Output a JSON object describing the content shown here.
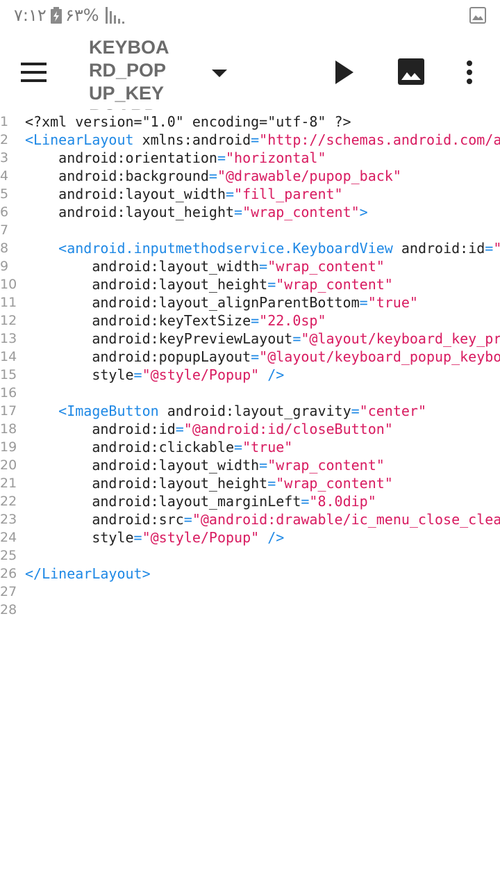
{
  "status_bar": {
    "time": "۷:۱۲",
    "battery": "۶۳%",
    "icons": [
      "battery-charging-icon",
      "signal-icon",
      "gallery-icon"
    ]
  },
  "toolbar": {
    "file_name": "KEYBOARD_POPUP_KEYBOARD",
    "icons": [
      "menu-icon",
      "dropdown-arrow-icon",
      "run-icon",
      "image-icon",
      "more-vert-icon"
    ]
  },
  "colors": {
    "tag": "#1e88e5",
    "value": "#d81b60",
    "plain": "#222222",
    "line_number": "#9a9a9a"
  },
  "editor": {
    "lines": [
      {
        "n": "1",
        "t": "<?xml version=\"1.0\" encoding=\"utf-8\" ?>"
      },
      {
        "n": "2",
        "t": "<LinearLayout xmlns:android=\"http://schemas.android.com/a"
      },
      {
        "n": "3",
        "t": "    android:orientation=\"horizontal\""
      },
      {
        "n": "4",
        "t": "    android:background=\"@drawable/pupop_back\""
      },
      {
        "n": "5",
        "t": "    android:layout_width=\"fill_parent\""
      },
      {
        "n": "6",
        "t": "    android:layout_height=\"wrap_content\">"
      },
      {
        "n": "7",
        "t": ""
      },
      {
        "n": "8",
        "t": "    <android.inputmethodservice.KeyboardView android:id=\""
      },
      {
        "n": "9",
        "t": "        android:layout_width=\"wrap_content\""
      },
      {
        "n": "10",
        "t": "        android:layout_height=\"wrap_content\""
      },
      {
        "n": "11",
        "t": "        android:layout_alignParentBottom=\"true\""
      },
      {
        "n": "12",
        "t": "        android:keyTextSize=\"22.0sp\""
      },
      {
        "n": "13",
        "t": "        android:keyPreviewLayout=\"@layout/keyboard_key_pr"
      },
      {
        "n": "14",
        "t": "        android:popupLayout=\"@layout/keyboard_popup_keybo"
      },
      {
        "n": "15",
        "t": "        style=\"@style/Popup\" />"
      },
      {
        "n": "16",
        "t": ""
      },
      {
        "n": "17",
        "t": "    <ImageButton android:layout_gravity=\"center\""
      },
      {
        "n": "18",
        "t": "        android:id=\"@android:id/closeButton\""
      },
      {
        "n": "19",
        "t": "        android:clickable=\"true\""
      },
      {
        "n": "20",
        "t": "        android:layout_width=\"wrap_content\""
      },
      {
        "n": "21",
        "t": "        android:layout_height=\"wrap_content\""
      },
      {
        "n": "22",
        "t": "        android:layout_marginLeft=\"8.0dip\""
      },
      {
        "n": "23",
        "t": "        android:src=\"@android:drawable/ic_menu_close_clea"
      },
      {
        "n": "24",
        "t": "        style=\"@style/Popup\" />"
      },
      {
        "n": "25",
        "t": ""
      },
      {
        "n": "26",
        "t": "</LinearLayout>"
      },
      {
        "n": "27",
        "t": ""
      },
      {
        "n": "28",
        "t": ""
      }
    ]
  }
}
